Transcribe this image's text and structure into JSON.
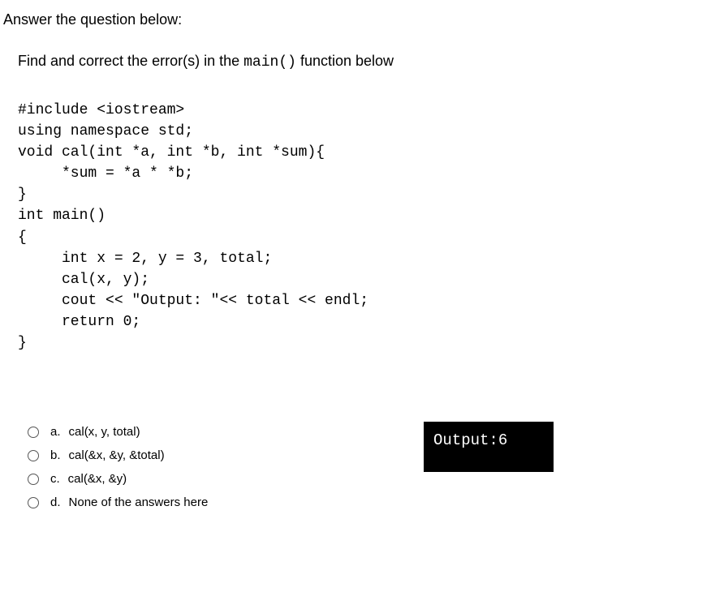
{
  "header": "Answer the question below:",
  "question_prefix": "Find and correct the error(s) in the ",
  "question_code": "main()",
  "question_suffix": " function below",
  "code": {
    "l1": "#include <iostream>",
    "l2": "using namespace std;",
    "l3": "void cal(int *a, int *b, int *sum){",
    "l4": "     *sum = *a * *b;",
    "l5": "}",
    "l6": "int main()",
    "l7": "{",
    "l8": "     int x = 2, y = 3, total;",
    "l9": "     cal(x, y);",
    "l10": "     cout << \"Output: \"<< total << endl;",
    "l11": "     return 0;",
    "l12": "}"
  },
  "output_box": "Output:6",
  "options": {
    "a": {
      "letter": "a.",
      "text": "cal(x, y, total)"
    },
    "b": {
      "letter": "b.",
      "text": "cal(&x, &y, &total)"
    },
    "c": {
      "letter": "c.",
      "text": "cal(&x, &y)"
    },
    "d": {
      "letter": "d.",
      "text": "None of the answers here"
    }
  }
}
